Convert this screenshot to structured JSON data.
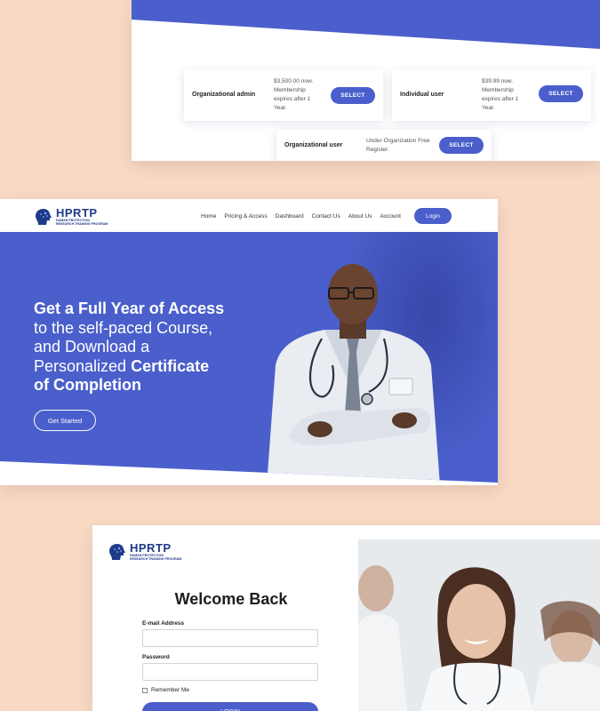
{
  "pricing": {
    "cards": [
      {
        "name": "Organizational admin",
        "desc": [
          "$3,500.00 now.",
          "Membership",
          "expires after 1",
          "Year."
        ],
        "button": "SELECT"
      },
      {
        "name": "Individual user",
        "desc": [
          "$39.99 now.",
          "Membership",
          "expires after 1",
          "Year."
        ],
        "button": "SELECT"
      },
      {
        "name": "Organizational user",
        "desc": [
          "Under Organization Free",
          "Register."
        ],
        "button": "SELECT"
      }
    ]
  },
  "logo": {
    "title": "HPRTP",
    "line1": "HUMAN PROTECTION",
    "line2": "RESEARCH TRAINING PROGRAM"
  },
  "nav": {
    "items": [
      "Home",
      "Pricing & Access",
      "Dashboard",
      "Contact Us",
      "About Us",
      "Account"
    ],
    "login": "Login"
  },
  "hero": {
    "line1": "Get a Full Year of Access",
    "line2": "to the self-paced Course,",
    "line3": "and Download a",
    "line4_light": "Personalized ",
    "line4_bold": "Certificate",
    "line5": "of Completion",
    "cta": "Get Started"
  },
  "login_form": {
    "title": "Welcome Back",
    "email_label": "E-mail Address",
    "password_label": "Password",
    "remember": "Remember Me",
    "submit": "LOGIN"
  },
  "colors": {
    "brand_blue": "#4a5fcb",
    "navy": "#1f3a8a",
    "background": "#f9d9c4"
  }
}
